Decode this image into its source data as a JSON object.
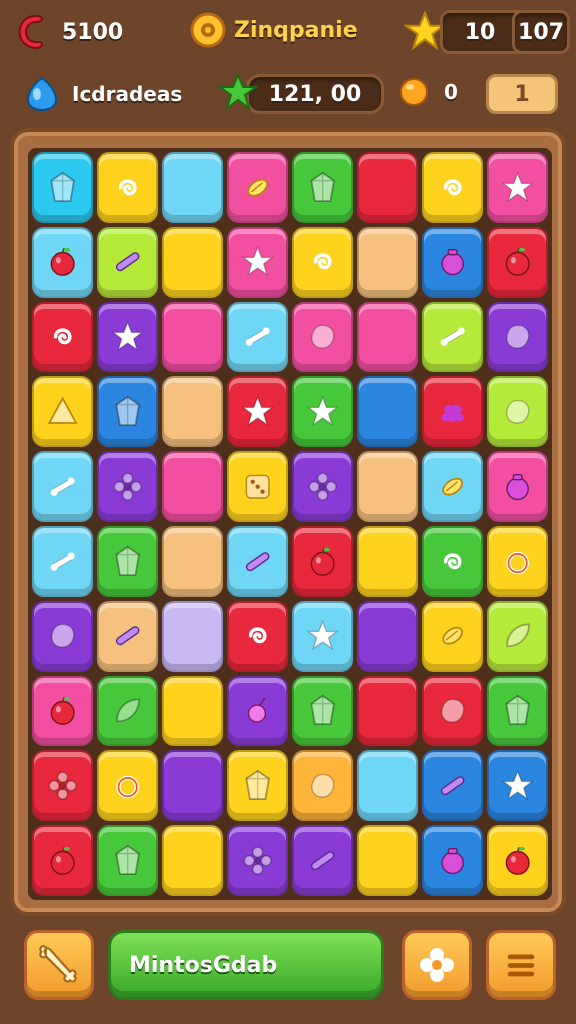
{
  "hud": {
    "lives": {
      "icon": "heart-icon",
      "value": "5100"
    },
    "title": {
      "icon": "coin-ring-icon",
      "text": "Zinqpanie"
    },
    "stars": {
      "icon": "star-icon",
      "count": "10",
      "best": "107"
    },
    "gems": {
      "icon": "drop-icon",
      "label": "Icdradeas"
    },
    "score": {
      "icon": "star-icon",
      "value": "121, 00"
    },
    "coins": {
      "icon": "coin-icon",
      "value": "0"
    },
    "moves": {
      "value": "1"
    }
  },
  "board": {
    "rows": 10,
    "cols": 8,
    "tiles": [
      [
        "cyan:gem",
        "yellow:swirl",
        "sky:none",
        "pink:candy",
        "green:gem",
        "red:none",
        "yellow:swirl",
        "pink:star"
      ],
      [
        "sky:apple",
        "lime:stick",
        "yellow:none",
        "pink:star",
        "yellow:swirl",
        "peach:none",
        "blue:pot",
        "red:apple"
      ],
      [
        "red:swirl",
        "purple:star",
        "pink:none",
        "sky:bone",
        "pink:blob",
        "pink:none",
        "lime:bone",
        "purple:blob"
      ],
      [
        "yellow:tri",
        "blue:gem",
        "peach:none",
        "red:star",
        "green:star",
        "blue:none",
        "red:grape",
        "lime:blob"
      ],
      [
        "sky:bone",
        "purple:flower",
        "pink:none",
        "yellow:dice",
        "purple:flower",
        "peach:none",
        "sky:candy",
        "pink:pot"
      ],
      [
        "sky:bone",
        "green:gem",
        "peach:none",
        "sky:stick",
        "red:apple",
        "yellow:none",
        "green:swirl",
        "yellow:ring"
      ],
      [
        "purple:blob",
        "peach:stick",
        "lavender:none",
        "red:swirl",
        "sky:star",
        "purple:none",
        "yellow:candy",
        "lime:leaf"
      ],
      [
        "pink:apple",
        "green:leaf",
        "yellow:none",
        "purple:drop",
        "green:gem",
        "red:none",
        "red:blob",
        "green:gem"
      ],
      [
        "red:flower",
        "yellow:ring",
        "purple:none",
        "yellow:gem",
        "orange:blob",
        "sky:none",
        "blue:stick",
        "blue:star"
      ],
      [
        "red:apple",
        "green:gem",
        "yellow:none",
        "purple:flower",
        "purple:stick",
        "yellow:none",
        "blue:pot",
        "yellow:apple"
      ]
    ]
  },
  "bottom": {
    "left_button": {
      "icon": "bone-icon"
    },
    "bar": {
      "label": "MintosGdab"
    },
    "middle_button": {
      "icon": "plus-icon"
    },
    "right_button": {
      "icon": "menu-icon"
    }
  },
  "colors": {
    "cyan": "#2bc8f0",
    "sky": "#6fd6f6",
    "yellow": "#ffd21e",
    "pink": "#f24fa0",
    "green": "#46c83a",
    "red": "#e8283c",
    "lime": "#b6ea3a",
    "peach": "#f6c07e",
    "blue": "#2b86df",
    "purple": "#8a3bd6",
    "lavender": "#c9b8f4",
    "orange": "#ffb43a"
  }
}
